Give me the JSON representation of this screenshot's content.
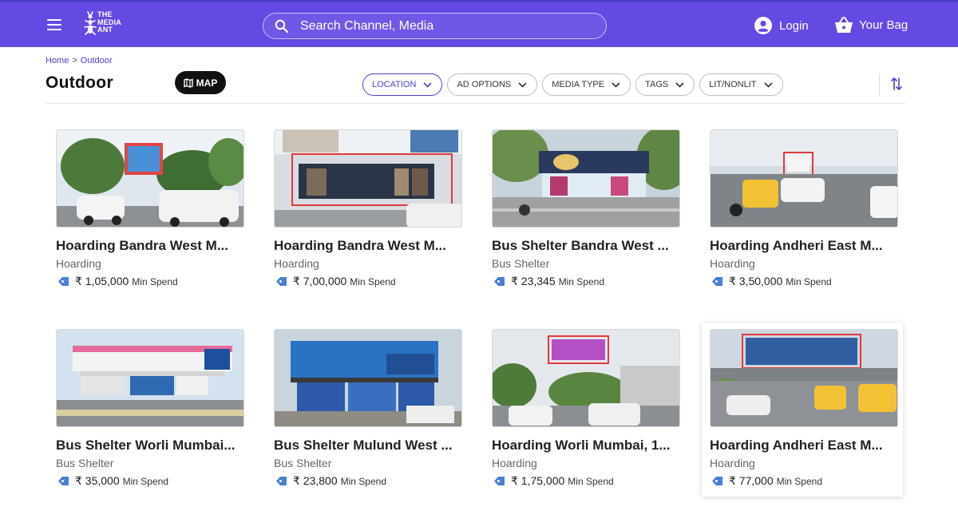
{
  "header": {
    "logo_text": "THE\nMEDIA\nANT",
    "search_placeholder": "Search Channel, Media",
    "login_label": "Login",
    "bag_label": "Your Bag"
  },
  "breadcrumb": {
    "home": "Home",
    "separator": ">",
    "current": "Outdoor"
  },
  "page_title": "Outdoor",
  "map_label": "MAP",
  "filters": [
    "LOCATION",
    "AD OPTIONS",
    "MEDIA TYPE",
    "TAGS",
    "LIT/NONLIT"
  ],
  "colors": {
    "brand": "#6549e3",
    "accent": "#4b3fd1",
    "tag": "#4a7fd6"
  },
  "cards": [
    {
      "title": "Hoarding Bandra West M...",
      "type": "Hoarding",
      "price": "₹ 1,05,000",
      "min_spend": "Min Spend"
    },
    {
      "title": "Hoarding Bandra West M...",
      "type": "Hoarding",
      "price": "₹ 7,00,000",
      "min_spend": "Min Spend"
    },
    {
      "title": "Bus Shelter Bandra West ...",
      "type": "Bus Shelter",
      "price": "₹ 23,345",
      "min_spend": "Min Spend"
    },
    {
      "title": "Hoarding Andheri East M...",
      "type": "Hoarding",
      "price": "₹ 3,50,000",
      "min_spend": "Min Spend"
    },
    {
      "title": "Bus Shelter Worli Mumbai...",
      "type": "Bus Shelter",
      "price": "₹ 35,000",
      "min_spend": "Min Spend"
    },
    {
      "title": "Bus Shelter Mulund West ...",
      "type": "Bus Shelter",
      "price": "₹ 23,800",
      "min_spend": "Min Spend"
    },
    {
      "title": "Hoarding Worli Mumbai, 1...",
      "type": "Hoarding",
      "price": "₹ 1,75,000",
      "min_spend": "Min Spend"
    },
    {
      "title": "Hoarding Andheri East M...",
      "type": "Hoarding",
      "price": "₹ 77,000",
      "min_spend": "Min Spend"
    }
  ]
}
